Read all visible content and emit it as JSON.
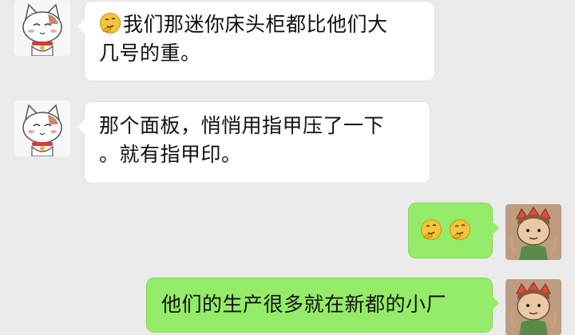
{
  "chat": {
    "messages": [
      {
        "sender": "other",
        "emoji": "thinking-face",
        "text": "我们那迷你床头柜都比他们大\n几号的重。"
      },
      {
        "sender": "other",
        "text": "那个面板，悄悄用指甲压了一下\n。就有指甲印。"
      },
      {
        "sender": "self",
        "emojis": [
          "thinking-face",
          "thinking-face"
        ]
      },
      {
        "sender": "self",
        "text": "他们的生产很多就在新都的小厂"
      }
    ]
  },
  "colors": {
    "background": "#ebebeb",
    "incoming_bubble": "#ffffff",
    "outgoing_bubble": "#95ec69"
  }
}
